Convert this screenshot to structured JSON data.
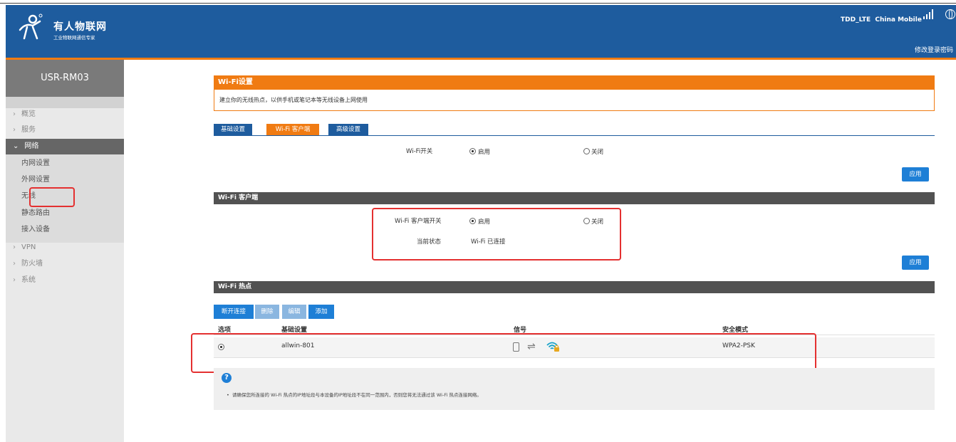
{
  "header": {
    "brand_name": "有人物联网",
    "brand_sub": "工业物联网通信专家",
    "network_status": "TDD_LTE  China Mobile",
    "change_login_label": "修改登录密码",
    "icons": [
      "signal-bars-icon",
      "globe-icon"
    ]
  },
  "sidebar": {
    "device_name": "USR-RM03",
    "items": [
      {
        "label": "概览"
      },
      {
        "label": "服务"
      },
      {
        "label": "网络"
      },
      {
        "label": "内网设置"
      },
      {
        "label": "外网设置"
      },
      {
        "label": "无线"
      },
      {
        "label": "静态路由"
      },
      {
        "label": "接入设备"
      },
      {
        "label": "VPN"
      },
      {
        "label": "防火墙"
      },
      {
        "label": "系统"
      }
    ]
  },
  "wifi_settings": {
    "title": "Wi-Fi设置",
    "description": "建立你的无线热点，以供手机或笔记本等无线设备上网使用",
    "tabs": [
      {
        "label": "基础设置",
        "color": "#1e5c9e"
      },
      {
        "label": "Wi-Fi 客户端",
        "color": "#f07b12"
      },
      {
        "label": "高级设置",
        "color": "#1e5c9e"
      }
    ],
    "wifi_switch_label": "Wi-Fi开关",
    "enable_label": "启用",
    "disable_label": "关闭",
    "apply_label": "应用"
  },
  "wifi_client": {
    "title": "Wi-Fi 客户端",
    "switch_label": "Wi-Fi 客户端开关",
    "enable_label": "启用",
    "disable_label": "关闭",
    "status_label": "当前状态",
    "status_value": "Wi-Fi 已连接",
    "apply_label": "应用"
  },
  "hotspots": {
    "title": "Wi-Fi 热点",
    "actions": {
      "disconnect": "断开连接",
      "delete": "删除",
      "edit": "编辑",
      "add": "添加"
    },
    "columns": {
      "option": "选项",
      "basic": "基础设置",
      "signal": "信号",
      "security": "安全模式"
    },
    "rows": [
      {
        "ssid": "allwin-801",
        "security": "WPA2-PSK",
        "selected": true,
        "icons": [
          "phone-icon",
          "exchange-arrows-icon",
          "wifi-lock-icon"
        ]
      }
    ],
    "note": "请确保您所连接的 Wi-Fi 热点的IP地址段与本设备的IP地址段不在同一范围内，否则您将无法通过该 Wi-Fi 热点连接网络。"
  },
  "colors": {
    "header_blue": "#1e5c9e",
    "accent_orange": "#f07b12",
    "button_blue": "#1e7fd6",
    "section_gray": "#525252",
    "highlight_red": "#e43030"
  }
}
